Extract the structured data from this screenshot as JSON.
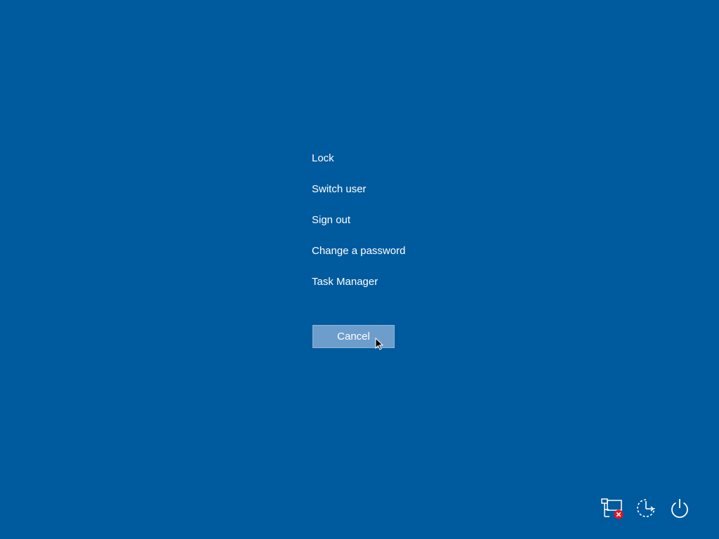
{
  "menu": {
    "items": [
      {
        "label": "Lock",
        "name": "menu-item-lock"
      },
      {
        "label": "Switch user",
        "name": "menu-item-switch-user"
      },
      {
        "label": "Sign out",
        "name": "menu-item-sign-out"
      },
      {
        "label": "Change a password",
        "name": "menu-item-change-password"
      },
      {
        "label": "Task Manager",
        "name": "menu-item-task-manager"
      }
    ]
  },
  "cancel": {
    "label": "Cancel"
  },
  "tray": {
    "network_icon": "network-disconnected-icon",
    "ease_of_access_icon": "ease-of-access-icon",
    "power_icon": "power-icon"
  },
  "colors": {
    "background": "#005a9e",
    "button": "#6d9ecb",
    "error_badge": "#e81123"
  }
}
